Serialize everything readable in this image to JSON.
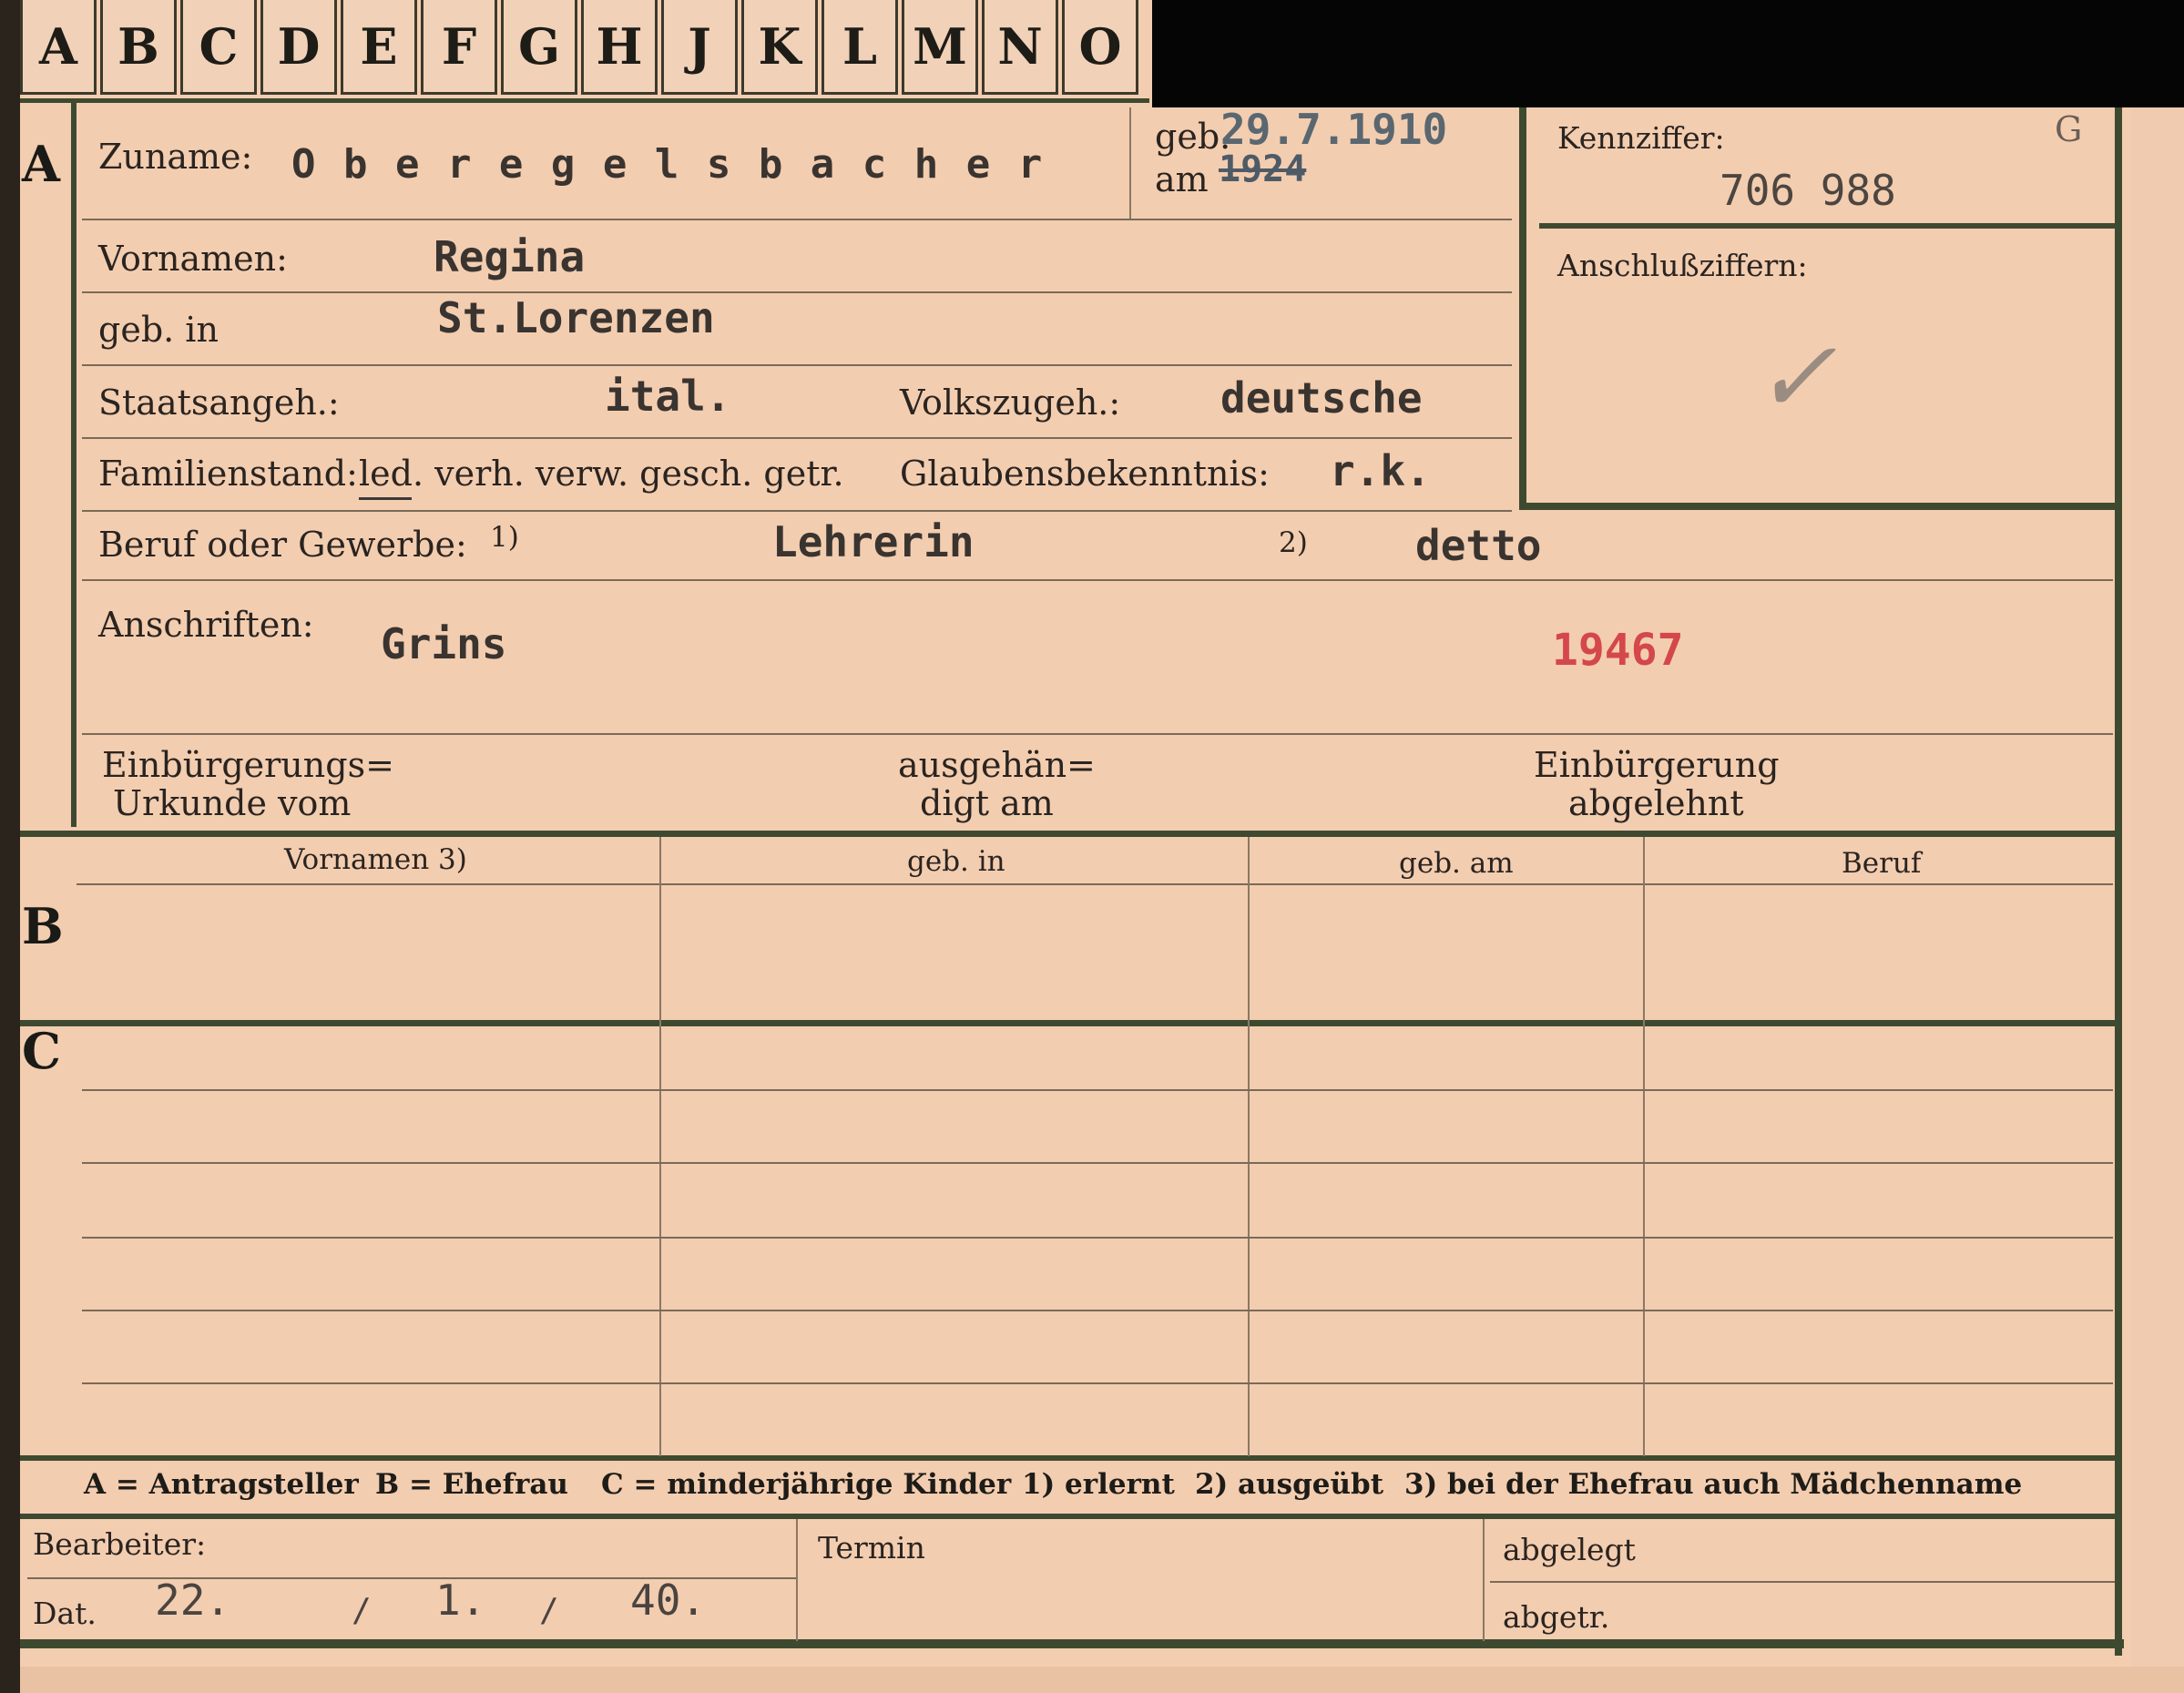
{
  "tabs": [
    "A",
    "B",
    "C",
    "D",
    "E",
    "F",
    "G",
    "H",
    "J",
    "K",
    "L",
    "M",
    "N",
    "O"
  ],
  "sections": {
    "a": "A",
    "b": "B",
    "c": "C"
  },
  "labels": {
    "zuname": "Zuname:",
    "geb_am_1": "geb.",
    "geb_am_2": "am",
    "kennziffer": "Kennziffer:",
    "vornamen": "Vornamen:",
    "anschlussziffern": "Anschlußziffern:",
    "geb_in": "geb. in",
    "staatsangeh": "Staatsangeh.:",
    "volkszugeh": "Volkszugeh.:",
    "familienstand": "Familienstand:",
    "fam_options": "led. verh. verw. gesch. getr.",
    "glaubensbekenntnis": "Glaubensbekenntnis:",
    "beruf": "Beruf oder Gewerbe:",
    "beruf_note1": "1)",
    "beruf_note2": "2)",
    "anschriften": "Anschriften:",
    "einb_1": "Einbürgerungs=",
    "einb_2": "Urkunde vom",
    "ausgeh_1": "ausgehän=",
    "ausgeh_2": "digt am",
    "abgel_1": "Einbürgerung",
    "abgel_2": "abgelehnt",
    "col_vornamen": "Vornamen 3)",
    "col_geb_in": "geb. in",
    "col_geb_am": "geb. am",
    "col_beruf": "Beruf",
    "bearbeiter": "Bearbeiter:",
    "dat": "Dat.",
    "termin": "Termin",
    "abgelegt": "abgelegt",
    "abgetr": "abgetr."
  },
  "legend": {
    "a": "A = Antragsteller",
    "b": "B = Ehefrau",
    "c": "C = minderjährige Kinder",
    "n1": "1) erlernt",
    "n2": "2) ausgeübt",
    "n3": "3) bei der Ehefrau auch Mädchenname"
  },
  "values": {
    "zuname": "O b e r e g e l s b a c h e r",
    "geb_date": "29.7.1910",
    "geb_struck": "1924",
    "kennziffer_letter": "G",
    "kennziffer": "706 988",
    "check": "✓",
    "vornamen": "Regina",
    "geb_in": "St.Lorenzen",
    "staatsangeh": "ital.",
    "volkszugeh": "deutsche",
    "glaube": "r.k.",
    "beruf1": "Lehrerin",
    "beruf2": "detto",
    "anschrift": "Grins",
    "stamp_no": "19467",
    "dat_d": "22.",
    "dat_m": "1.",
    "dat_y": "40.",
    "slash1": "/",
    "slash2": "/"
  },
  "colors": {
    "paper": "#f3cdb0",
    "ink": "#2b2320",
    "stamp": "#d4474a",
    "frame": "#3e4a30"
  }
}
